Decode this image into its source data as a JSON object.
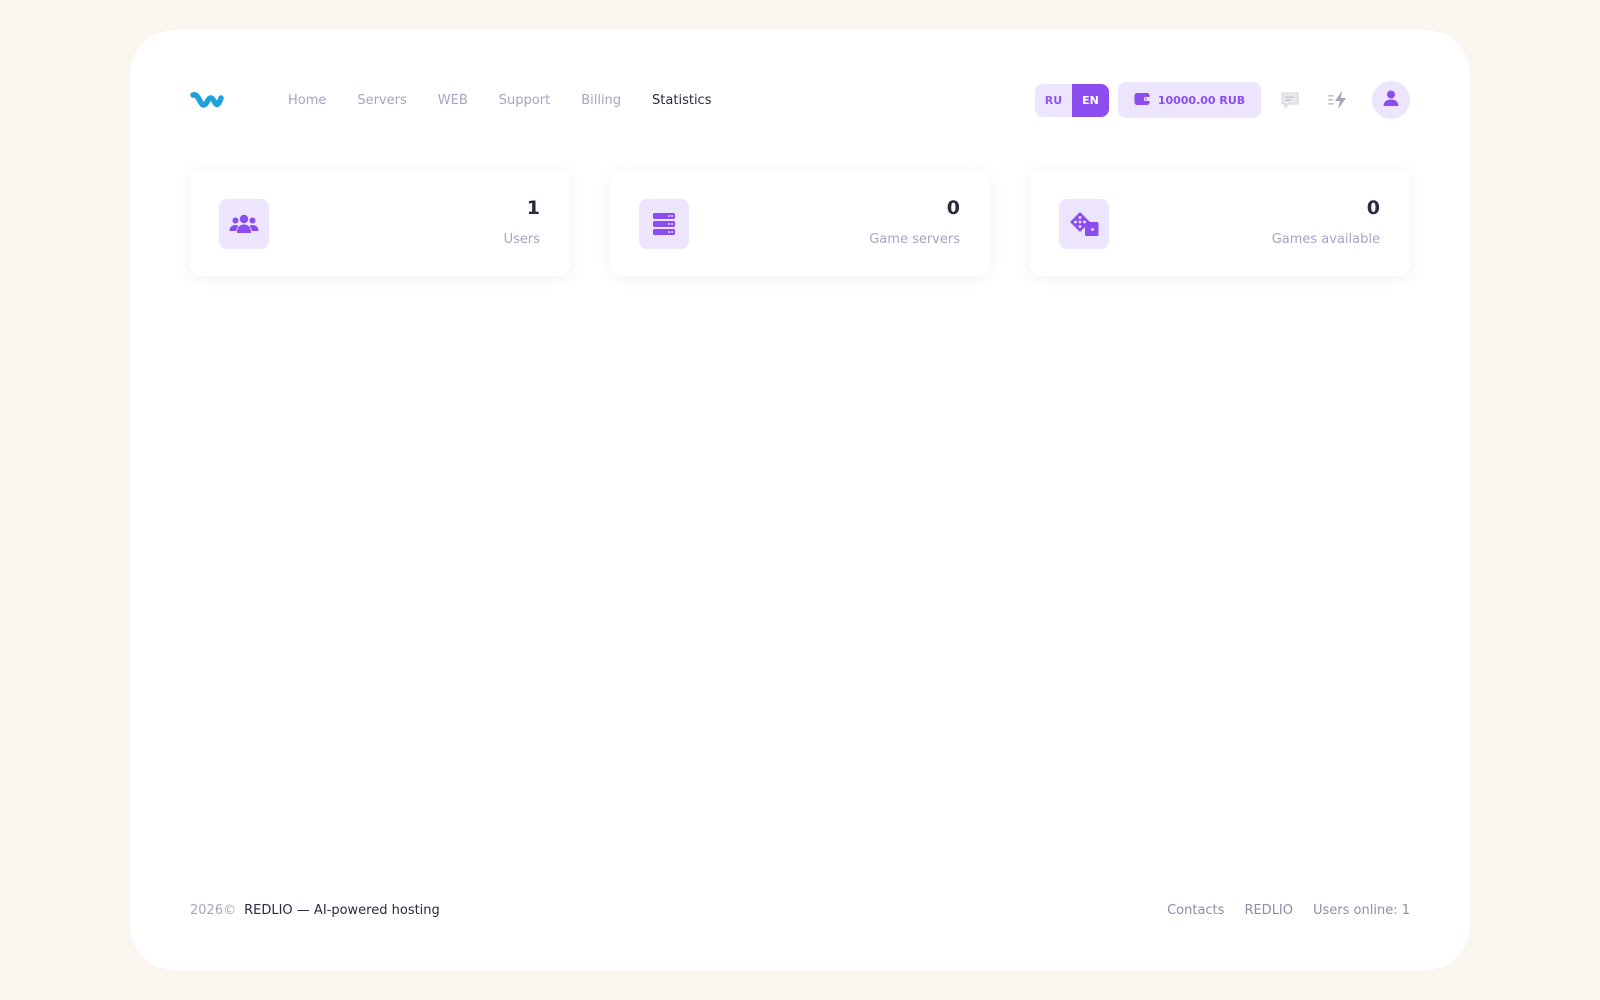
{
  "nav": {
    "items": [
      {
        "label": "Home",
        "active": false
      },
      {
        "label": "Servers",
        "active": false
      },
      {
        "label": "WEB",
        "active": false
      },
      {
        "label": "Support",
        "active": false
      },
      {
        "label": "Billing",
        "active": false
      },
      {
        "label": "Statistics",
        "active": true
      }
    ]
  },
  "lang": {
    "ru": "RU",
    "en": "EN",
    "selected": "EN"
  },
  "balance": {
    "label": "10000.00 RUB",
    "icon": "wallet-icon"
  },
  "header_icons": [
    "chat-icon",
    "bolt-icon",
    "user-icon"
  ],
  "stats": [
    {
      "value": "1",
      "label": "Users",
      "icon": "users-icon"
    },
    {
      "value": "0",
      "label": "Game servers",
      "icon": "server-icon"
    },
    {
      "value": "0",
      "label": "Games available",
      "icon": "dice-icon"
    }
  ],
  "footer": {
    "year": "2026©",
    "copyright": "REDLIO — AI-powered hosting",
    "links": [
      "Contacts",
      "REDLIO"
    ],
    "online": "Users online: 1"
  },
  "colors": {
    "background": "#faf5ee",
    "card": "#ffffff",
    "accent": "#8b4cf0",
    "accent_soft": "#ede5fd",
    "text_dark": "#2b2a40",
    "text_muted": "#a6a4c2",
    "logo": "#1fa0d8"
  }
}
